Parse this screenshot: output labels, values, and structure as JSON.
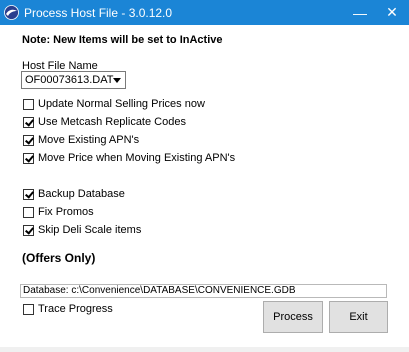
{
  "window": {
    "title": "Process Host File - 3.0.12.0",
    "minimize_glyph": "—",
    "close_glyph": "✕"
  },
  "note": "Note: New Items will be set to InActive",
  "host_file": {
    "label": "Host File Name",
    "selected": "OF00073613.DAT"
  },
  "options_group1": [
    {
      "label": "Update Normal Selling Prices now",
      "checked": false
    },
    {
      "label": "Use Metcash Replicate Codes",
      "checked": true
    },
    {
      "label": "Move Existing APN's",
      "checked": true
    },
    {
      "label": "Move Price when Moving Existing APN's",
      "checked": true
    }
  ],
  "options_group2": [
    {
      "label": "Backup Database",
      "checked": true
    },
    {
      "label": "Fix Promos",
      "checked": false
    },
    {
      "label": "Skip Deli Scale items",
      "checked": true
    }
  ],
  "offers_only": "(Offers Only)",
  "database_path": "Database: c:\\Convenience\\DATABASE\\CONVENIENCE.GDB",
  "trace_progress": {
    "label": "Trace Progress",
    "checked": false
  },
  "buttons": {
    "process": "Process",
    "exit": "Exit"
  },
  "colors": {
    "titlebar": "#1b85d6",
    "button_face": "#e1e1e1"
  }
}
